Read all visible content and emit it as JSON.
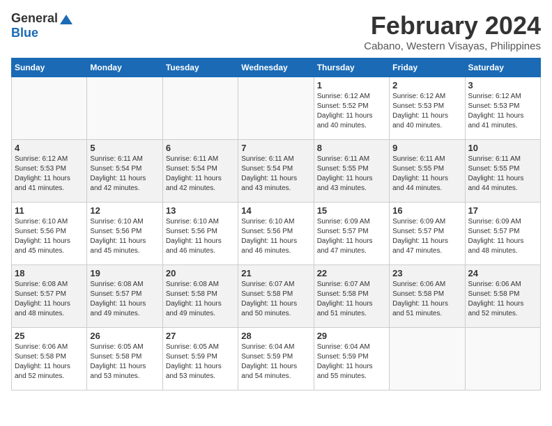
{
  "logo": {
    "general": "General",
    "blue": "Blue"
  },
  "title": "February 2024",
  "subtitle": "Cabano, Western Visayas, Philippines",
  "days_header": [
    "Sunday",
    "Monday",
    "Tuesday",
    "Wednesday",
    "Thursday",
    "Friday",
    "Saturday"
  ],
  "weeks": [
    [
      {
        "day": "",
        "info": ""
      },
      {
        "day": "",
        "info": ""
      },
      {
        "day": "",
        "info": ""
      },
      {
        "day": "",
        "info": ""
      },
      {
        "day": "1",
        "info": "Sunrise: 6:12 AM\nSunset: 5:52 PM\nDaylight: 11 hours\nand 40 minutes."
      },
      {
        "day": "2",
        "info": "Sunrise: 6:12 AM\nSunset: 5:53 PM\nDaylight: 11 hours\nand 40 minutes."
      },
      {
        "day": "3",
        "info": "Sunrise: 6:12 AM\nSunset: 5:53 PM\nDaylight: 11 hours\nand 41 minutes."
      }
    ],
    [
      {
        "day": "4",
        "info": "Sunrise: 6:12 AM\nSunset: 5:53 PM\nDaylight: 11 hours\nand 41 minutes."
      },
      {
        "day": "5",
        "info": "Sunrise: 6:11 AM\nSunset: 5:54 PM\nDaylight: 11 hours\nand 42 minutes."
      },
      {
        "day": "6",
        "info": "Sunrise: 6:11 AM\nSunset: 5:54 PM\nDaylight: 11 hours\nand 42 minutes."
      },
      {
        "day": "7",
        "info": "Sunrise: 6:11 AM\nSunset: 5:54 PM\nDaylight: 11 hours\nand 43 minutes."
      },
      {
        "day": "8",
        "info": "Sunrise: 6:11 AM\nSunset: 5:55 PM\nDaylight: 11 hours\nand 43 minutes."
      },
      {
        "day": "9",
        "info": "Sunrise: 6:11 AM\nSunset: 5:55 PM\nDaylight: 11 hours\nand 44 minutes."
      },
      {
        "day": "10",
        "info": "Sunrise: 6:11 AM\nSunset: 5:55 PM\nDaylight: 11 hours\nand 44 minutes."
      }
    ],
    [
      {
        "day": "11",
        "info": "Sunrise: 6:10 AM\nSunset: 5:56 PM\nDaylight: 11 hours\nand 45 minutes."
      },
      {
        "day": "12",
        "info": "Sunrise: 6:10 AM\nSunset: 5:56 PM\nDaylight: 11 hours\nand 45 minutes."
      },
      {
        "day": "13",
        "info": "Sunrise: 6:10 AM\nSunset: 5:56 PM\nDaylight: 11 hours\nand 46 minutes."
      },
      {
        "day": "14",
        "info": "Sunrise: 6:10 AM\nSunset: 5:56 PM\nDaylight: 11 hours\nand 46 minutes."
      },
      {
        "day": "15",
        "info": "Sunrise: 6:09 AM\nSunset: 5:57 PM\nDaylight: 11 hours\nand 47 minutes."
      },
      {
        "day": "16",
        "info": "Sunrise: 6:09 AM\nSunset: 5:57 PM\nDaylight: 11 hours\nand 47 minutes."
      },
      {
        "day": "17",
        "info": "Sunrise: 6:09 AM\nSunset: 5:57 PM\nDaylight: 11 hours\nand 48 minutes."
      }
    ],
    [
      {
        "day": "18",
        "info": "Sunrise: 6:08 AM\nSunset: 5:57 PM\nDaylight: 11 hours\nand 48 minutes."
      },
      {
        "day": "19",
        "info": "Sunrise: 6:08 AM\nSunset: 5:57 PM\nDaylight: 11 hours\nand 49 minutes."
      },
      {
        "day": "20",
        "info": "Sunrise: 6:08 AM\nSunset: 5:58 PM\nDaylight: 11 hours\nand 49 minutes."
      },
      {
        "day": "21",
        "info": "Sunrise: 6:07 AM\nSunset: 5:58 PM\nDaylight: 11 hours\nand 50 minutes."
      },
      {
        "day": "22",
        "info": "Sunrise: 6:07 AM\nSunset: 5:58 PM\nDaylight: 11 hours\nand 51 minutes."
      },
      {
        "day": "23",
        "info": "Sunrise: 6:06 AM\nSunset: 5:58 PM\nDaylight: 11 hours\nand 51 minutes."
      },
      {
        "day": "24",
        "info": "Sunrise: 6:06 AM\nSunset: 5:58 PM\nDaylight: 11 hours\nand 52 minutes."
      }
    ],
    [
      {
        "day": "25",
        "info": "Sunrise: 6:06 AM\nSunset: 5:58 PM\nDaylight: 11 hours\nand 52 minutes."
      },
      {
        "day": "26",
        "info": "Sunrise: 6:05 AM\nSunset: 5:58 PM\nDaylight: 11 hours\nand 53 minutes."
      },
      {
        "day": "27",
        "info": "Sunrise: 6:05 AM\nSunset: 5:59 PM\nDaylight: 11 hours\nand 53 minutes."
      },
      {
        "day": "28",
        "info": "Sunrise: 6:04 AM\nSunset: 5:59 PM\nDaylight: 11 hours\nand 54 minutes."
      },
      {
        "day": "29",
        "info": "Sunrise: 6:04 AM\nSunset: 5:59 PM\nDaylight: 11 hours\nand 55 minutes."
      },
      {
        "day": "",
        "info": ""
      },
      {
        "day": "",
        "info": ""
      }
    ]
  ]
}
